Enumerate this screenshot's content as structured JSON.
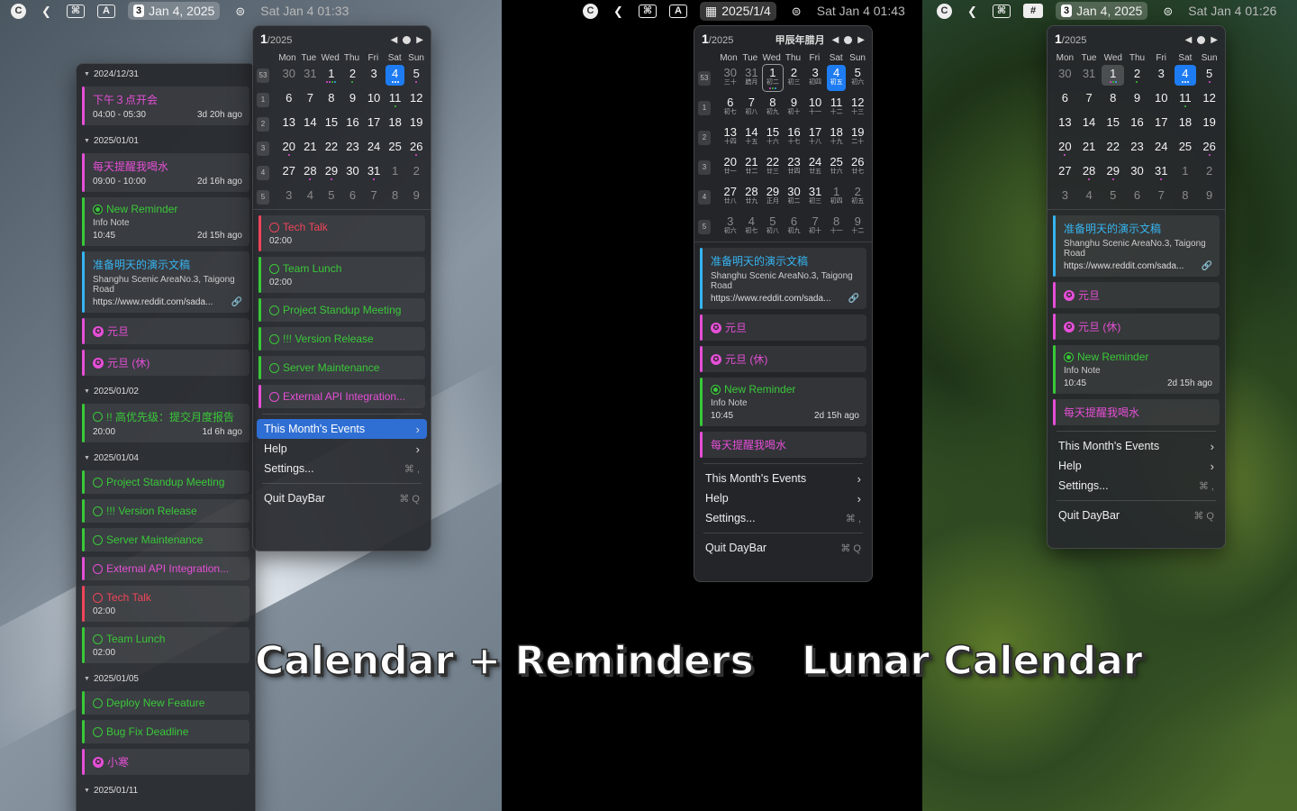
{
  "captions": {
    "left": "Calendar + Reminders",
    "right": "Lunar Calendar"
  },
  "colors": {
    "pink": "#e54fd6",
    "green": "#3ac839",
    "cyan": "#36b4f0",
    "red": "#f0445a",
    "blue": "#1e7cf2",
    "orange": "#f0a030"
  },
  "dows": [
    "Mon",
    "Tue",
    "Wed",
    "Thu",
    "Fri",
    "Sat",
    "Sun"
  ],
  "menu_items": {
    "events": "This Month's Events",
    "help": "Help",
    "settings": "Settings...",
    "settings_key": "⌘ ,",
    "quit": "Quit DayBar",
    "quit_key": "⌘ Q"
  },
  "screenA": {
    "menubar": {
      "icons": [
        "C",
        "❮",
        "⌘",
        "A"
      ],
      "icon_names": [
        "app-icon",
        "back-icon",
        "control-icon",
        "input-icon"
      ],
      "daynum": "3",
      "date": "Jan 4, 2025",
      "time": "Sat Jan 4  01:33"
    },
    "calendar": {
      "month": "1",
      "year": "/2025",
      "weeks": [
        {
          "wk": "53",
          "days": [
            {
              "d": "30",
              "dim": true
            },
            {
              "d": "31",
              "dim": true
            },
            {
              "d": "1",
              "dots": [
                "#e54fd6",
                "#e54fd6",
                "#3ac839",
                "#36b4f0"
              ]
            },
            {
              "d": "2",
              "dots": [
                "#3ac839"
              ]
            },
            {
              "d": "3"
            },
            {
              "d": "4",
              "today": true,
              "dots": [
                "#ffffff",
                "#ffffff",
                "#ffffff"
              ]
            },
            {
              "d": "5",
              "dots": [
                "#e54fd6"
              ]
            }
          ]
        },
        {
          "wk": "1",
          "days": [
            {
              "d": "6"
            },
            {
              "d": "7"
            },
            {
              "d": "8"
            },
            {
              "d": "9"
            },
            {
              "d": "10"
            },
            {
              "d": "11",
              "dots": [
                "#3ac839"
              ]
            },
            {
              "d": "12"
            }
          ]
        },
        {
          "wk": "2",
          "days": [
            {
              "d": "13"
            },
            {
              "d": "14"
            },
            {
              "d": "15"
            },
            {
              "d": "16"
            },
            {
              "d": "17"
            },
            {
              "d": "18"
            },
            {
              "d": "19"
            }
          ]
        },
        {
          "wk": "3",
          "days": [
            {
              "d": "20",
              "dots": [
                "#e54fd6"
              ]
            },
            {
              "d": "21"
            },
            {
              "d": "22"
            },
            {
              "d": "23"
            },
            {
              "d": "24"
            },
            {
              "d": "25"
            },
            {
              "d": "26",
              "dots": [
                "#e54fd6"
              ]
            }
          ]
        },
        {
          "wk": "4",
          "days": [
            {
              "d": "27"
            },
            {
              "d": "28",
              "dots": [
                "#e54fd6"
              ]
            },
            {
              "d": "29",
              "dots": [
                "#e54fd6"
              ]
            },
            {
              "d": "30"
            },
            {
              "d": "31",
              "dots": [
                "#e54fd6"
              ]
            },
            {
              "d": "1",
              "dim": true
            },
            {
              "d": "2",
              "dim": true
            }
          ]
        },
        {
          "wk": "5",
          "days": [
            {
              "d": "3",
              "dim": true
            },
            {
              "d": "4",
              "dim": true
            },
            {
              "d": "5",
              "dim": true
            },
            {
              "d": "6",
              "dim": true
            },
            {
              "d": "7",
              "dim": true
            },
            {
              "d": "8",
              "dim": true
            },
            {
              "d": "9",
              "dim": true
            }
          ]
        }
      ]
    },
    "events": [
      {
        "title": "Tech Talk",
        "icon": "ring",
        "c": "red",
        "time": "02:00"
      },
      {
        "title": "Team Lunch",
        "icon": "ring",
        "c": "green",
        "time": "02:00"
      },
      {
        "title": "Project Standup Meeting",
        "icon": "ring",
        "c": "green"
      },
      {
        "title": "!!! Version Release",
        "icon": "ring",
        "c": "green"
      },
      {
        "title": "Server Maintenance",
        "icon": "ring",
        "c": "green"
      },
      {
        "title": "External API Integration...",
        "icon": "ring",
        "c": "pink"
      }
    ],
    "sidebar": [
      {
        "date": "2024/12/31",
        "items": [
          {
            "title": "下午３点开会",
            "c": "pink",
            "time": "04:00 - 05:30",
            "ago": "3d 20h ago"
          }
        ]
      },
      {
        "date": "2025/01/01",
        "items": [
          {
            "title": "每天提醒我喝水",
            "c": "pink",
            "time": "09:00 - 10:00",
            "ago": "2d 16h ago"
          },
          {
            "title": "New Reminder",
            "icon": "ringfull",
            "c": "green",
            "sub": "Info Note",
            "time": "10:45",
            "ago": "2d 15h ago"
          },
          {
            "title": "准备明天的演示文稿",
            "c": "cyan",
            "sub": "Shanghu Scenic AreaNo.3, Taigong Road",
            "url": "https://www.reddit.com/sada..."
          },
          {
            "title": "元旦",
            "icon": "holi",
            "c": "pink"
          },
          {
            "title": "元旦 (休)",
            "icon": "holi",
            "c": "pink"
          }
        ]
      },
      {
        "date": "2025/01/02",
        "items": [
          {
            "title": "!! 高优先级：提交月度报告",
            "icon": "ring",
            "c": "green",
            "time": "20:00",
            "ago": "1d 6h ago"
          }
        ]
      },
      {
        "date": "2025/01/04",
        "items": [
          {
            "title": "Project Standup Meeting",
            "icon": "ring",
            "c": "green"
          },
          {
            "title": "!!! Version Release",
            "icon": "ring",
            "c": "green"
          },
          {
            "title": "Server Maintenance",
            "icon": "ring",
            "c": "green"
          },
          {
            "title": "External API Integration...",
            "icon": "ring",
            "c": "pink"
          },
          {
            "title": "Tech Talk",
            "icon": "ring",
            "c": "red",
            "time": "02:00"
          },
          {
            "title": "Team Lunch",
            "icon": "ring",
            "c": "green",
            "time": "02:00"
          }
        ]
      },
      {
        "date": "2025/01/05",
        "items": [
          {
            "title": "Deploy New Feature",
            "icon": "ring",
            "c": "green"
          },
          {
            "title": "Bug Fix Deadline",
            "icon": "ring",
            "c": "green"
          },
          {
            "title": "小寒",
            "icon": "holi",
            "c": "pink"
          }
        ]
      },
      {
        "date": "2025/01/11",
        "items": []
      }
    ]
  },
  "screenB": {
    "menubar": {
      "icons": [
        "C",
        "❮",
        "⌘",
        "A"
      ],
      "icon_names": [
        "app-icon",
        "back-icon",
        "control-icon",
        "input-icon"
      ],
      "cal_ico": "▦",
      "date": "2025/1/4",
      "time": "Sat Jan 4  01:43"
    },
    "calendar": {
      "month": "1",
      "year": "/2025",
      "lunar": "甲辰年腊月",
      "weeks": [
        {
          "wk": "53",
          "days": [
            {
              "d": "30",
              "l": "三十",
              "dim": true
            },
            {
              "d": "31",
              "l": "腊月",
              "dim": true
            },
            {
              "d": "1",
              "l": "初二",
              "sel": true,
              "dots": [
                "#e54fd6",
                "#3ac839",
                "#36b4f0"
              ]
            },
            {
              "d": "2",
              "l": "初三"
            },
            {
              "d": "3",
              "l": "初四"
            },
            {
              "d": "4",
              "l": "初五",
              "today": true
            },
            {
              "d": "5",
              "l": "初六"
            }
          ]
        },
        {
          "wk": "1",
          "days": [
            {
              "d": "6",
              "l": "初七"
            },
            {
              "d": "7",
              "l": "初八"
            },
            {
              "d": "8",
              "l": "初九"
            },
            {
              "d": "9",
              "l": "初十"
            },
            {
              "d": "10",
              "l": "十一"
            },
            {
              "d": "11",
              "l": "十二"
            },
            {
              "d": "12",
              "l": "十三"
            }
          ]
        },
        {
          "wk": "2",
          "days": [
            {
              "d": "13",
              "l": "十四"
            },
            {
              "d": "14",
              "l": "十五"
            },
            {
              "d": "15",
              "l": "十六"
            },
            {
              "d": "16",
              "l": "十七"
            },
            {
              "d": "17",
              "l": "十八"
            },
            {
              "d": "18",
              "l": "十九"
            },
            {
              "d": "19",
              "l": "二十"
            }
          ]
        },
        {
          "wk": "3",
          "days": [
            {
              "d": "20",
              "l": "廿一"
            },
            {
              "d": "21",
              "l": "廿二"
            },
            {
              "d": "22",
              "l": "廿三"
            },
            {
              "d": "23",
              "l": "廿四"
            },
            {
              "d": "24",
              "l": "廿五"
            },
            {
              "d": "25",
              "l": "廿六"
            },
            {
              "d": "26",
              "l": "廿七"
            }
          ]
        },
        {
          "wk": "4",
          "days": [
            {
              "d": "27",
              "l": "廿八"
            },
            {
              "d": "28",
              "l": "廿九"
            },
            {
              "d": "29",
              "l": "正月"
            },
            {
              "d": "30",
              "l": "初二"
            },
            {
              "d": "31",
              "l": "初三"
            },
            {
              "d": "1",
              "l": "初四",
              "dim": true
            },
            {
              "d": "2",
              "l": "初五",
              "dim": true
            }
          ]
        },
        {
          "wk": "5",
          "days": [
            {
              "d": "3",
              "l": "初六",
              "dim": true
            },
            {
              "d": "4",
              "l": "初七",
              "dim": true
            },
            {
              "d": "5",
              "l": "初八",
              "dim": true
            },
            {
              "d": "6",
              "l": "初九",
              "dim": true
            },
            {
              "d": "7",
              "l": "初十",
              "dim": true
            },
            {
              "d": "8",
              "l": "十一",
              "dim": true
            },
            {
              "d": "9",
              "l": "十二",
              "dim": true
            }
          ]
        }
      ]
    },
    "events": [
      {
        "title": "准备明天的演示文稿",
        "c": "cyan",
        "sub": "Shanghu Scenic AreaNo.3, Taigong Road",
        "url": "https://www.reddit.com/sada..."
      },
      {
        "title": "元旦",
        "icon": "holi",
        "c": "pink"
      },
      {
        "title": "元旦 (休)",
        "icon": "holi",
        "c": "pink"
      },
      {
        "title": "New Reminder",
        "icon": "ringfull",
        "c": "green",
        "sub": "Info Note",
        "time": "10:45",
        "ago": "2d 15h ago"
      },
      {
        "title": "每天提醒我喝水",
        "c": "pink"
      }
    ]
  },
  "screenC": {
    "menubar": {
      "icons": [
        "C",
        "❮",
        "⌘",
        "#"
      ],
      "icon_names": [
        "app-icon",
        "back-icon",
        "control-icon",
        "grid-icon"
      ],
      "daynum": "3",
      "date": "Jan 4, 2025",
      "time": "Sat Jan 4  01:26"
    },
    "calendar": {
      "month": "1",
      "year": "/2025",
      "weeks": [
        {
          "days": [
            {
              "d": "30",
              "dim": true
            },
            {
              "d": "31",
              "dim": true
            },
            {
              "d": "1",
              "selfill": true,
              "dots": [
                "#e54fd6",
                "#3ac839",
                "#36b4f0"
              ]
            },
            {
              "d": "2",
              "dots": [
                "#3ac839"
              ]
            },
            {
              "d": "3"
            },
            {
              "d": "4",
              "today": true,
              "dots": [
                "#ffffff",
                "#ffffff",
                "#ffffff"
              ]
            },
            {
              "d": "5",
              "dots": [
                "#e54fd6"
              ]
            }
          ]
        },
        {
          "days": [
            {
              "d": "6"
            },
            {
              "d": "7"
            },
            {
              "d": "8"
            },
            {
              "d": "9"
            },
            {
              "d": "10"
            },
            {
              "d": "11",
              "dots": [
                "#3ac839"
              ]
            },
            {
              "d": "12"
            }
          ]
        },
        {
          "days": [
            {
              "d": "13"
            },
            {
              "d": "14"
            },
            {
              "d": "15"
            },
            {
              "d": "16"
            },
            {
              "d": "17"
            },
            {
              "d": "18"
            },
            {
              "d": "19"
            }
          ]
        },
        {
          "days": [
            {
              "d": "20",
              "dots": [
                "#e54fd6"
              ]
            },
            {
              "d": "21"
            },
            {
              "d": "22"
            },
            {
              "d": "23"
            },
            {
              "d": "24"
            },
            {
              "d": "25"
            },
            {
              "d": "26",
              "dots": [
                "#e54fd6"
              ]
            }
          ]
        },
        {
          "days": [
            {
              "d": "27"
            },
            {
              "d": "28",
              "dots": [
                "#e54fd6"
              ]
            },
            {
              "d": "29",
              "dots": [
                "#e54fd6"
              ]
            },
            {
              "d": "30"
            },
            {
              "d": "31",
              "dots": [
                "#e54fd6"
              ]
            },
            {
              "d": "1",
              "dim": true
            },
            {
              "d": "2",
              "dim": true
            }
          ]
        },
        {
          "days": [
            {
              "d": "3",
              "dim": true
            },
            {
              "d": "4",
              "dim": true
            },
            {
              "d": "5",
              "dim": true
            },
            {
              "d": "6",
              "dim": true
            },
            {
              "d": "7",
              "dim": true
            },
            {
              "d": "8",
              "dim": true
            },
            {
              "d": "9",
              "dim": true
            }
          ]
        }
      ]
    },
    "events": [
      {
        "title": "准备明天的演示文稿",
        "c": "cyan",
        "sub": "Shanghu Scenic AreaNo.3, Taigong Road",
        "url": "https://www.reddit.com/sada..."
      },
      {
        "title": "元旦",
        "icon": "holi",
        "c": "pink"
      },
      {
        "title": "元旦 (休)",
        "icon": "holi",
        "c": "pink"
      },
      {
        "title": "New Reminder",
        "icon": "ringfull",
        "c": "green",
        "sub": "Info Note",
        "time": "10:45",
        "ago": "2d 15h ago"
      },
      {
        "title": "每天提醒我喝水",
        "c": "pink"
      }
    ]
  }
}
